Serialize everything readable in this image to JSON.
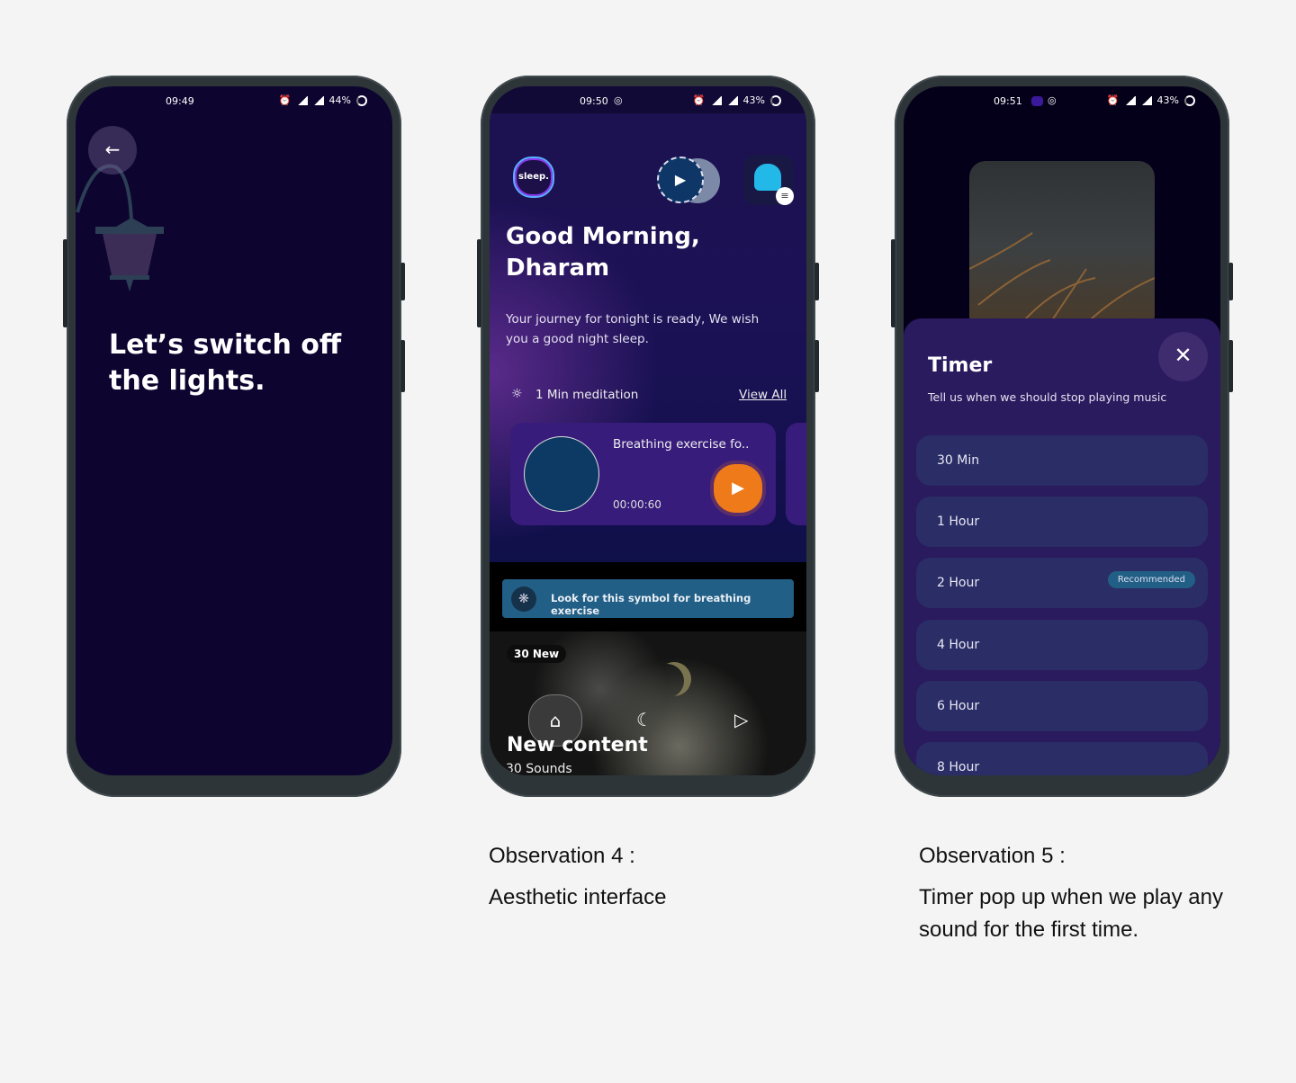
{
  "phone1": {
    "time": "09:49",
    "battery": "44%",
    "headline": "Let’s switch off the lights."
  },
  "phone2": {
    "time": "09:50",
    "battery": "43%",
    "logo": "sleep.",
    "greeting": "Good Morning, Dharam",
    "subtitle": "Your journey for tonight is ready, We wish you a good night sleep.",
    "section": "1 Min meditation",
    "view_all": "View All",
    "card": {
      "title": "Breathing exercise fo..",
      "duration": "00:00:60"
    },
    "tip": "Look for this symbol for breathing exercise",
    "badge": "30 New",
    "feature_title": "New content",
    "feature_sub": "30 Sounds"
  },
  "phone3": {
    "time": "09:51",
    "battery": "43%",
    "title": "Timer",
    "subtitle": "Tell us when we should stop playing music",
    "options": [
      "30 Min",
      "1 Hour",
      "2 Hour",
      "4 Hour",
      "6 Hour",
      "8 Hour"
    ],
    "recommended": "Recommended"
  },
  "captions": {
    "obs4_title": "Observation 4 :",
    "obs4_text": "Aesthetic interface",
    "obs5_title": "Observation 5 :",
    "obs5_text": "Timer pop up when we play any sound for the first time."
  },
  "colors": {
    "night": "#0d0530",
    "purple": "#2a1a5e",
    "accent": "#ef7a1a",
    "teal": "#225f86"
  }
}
